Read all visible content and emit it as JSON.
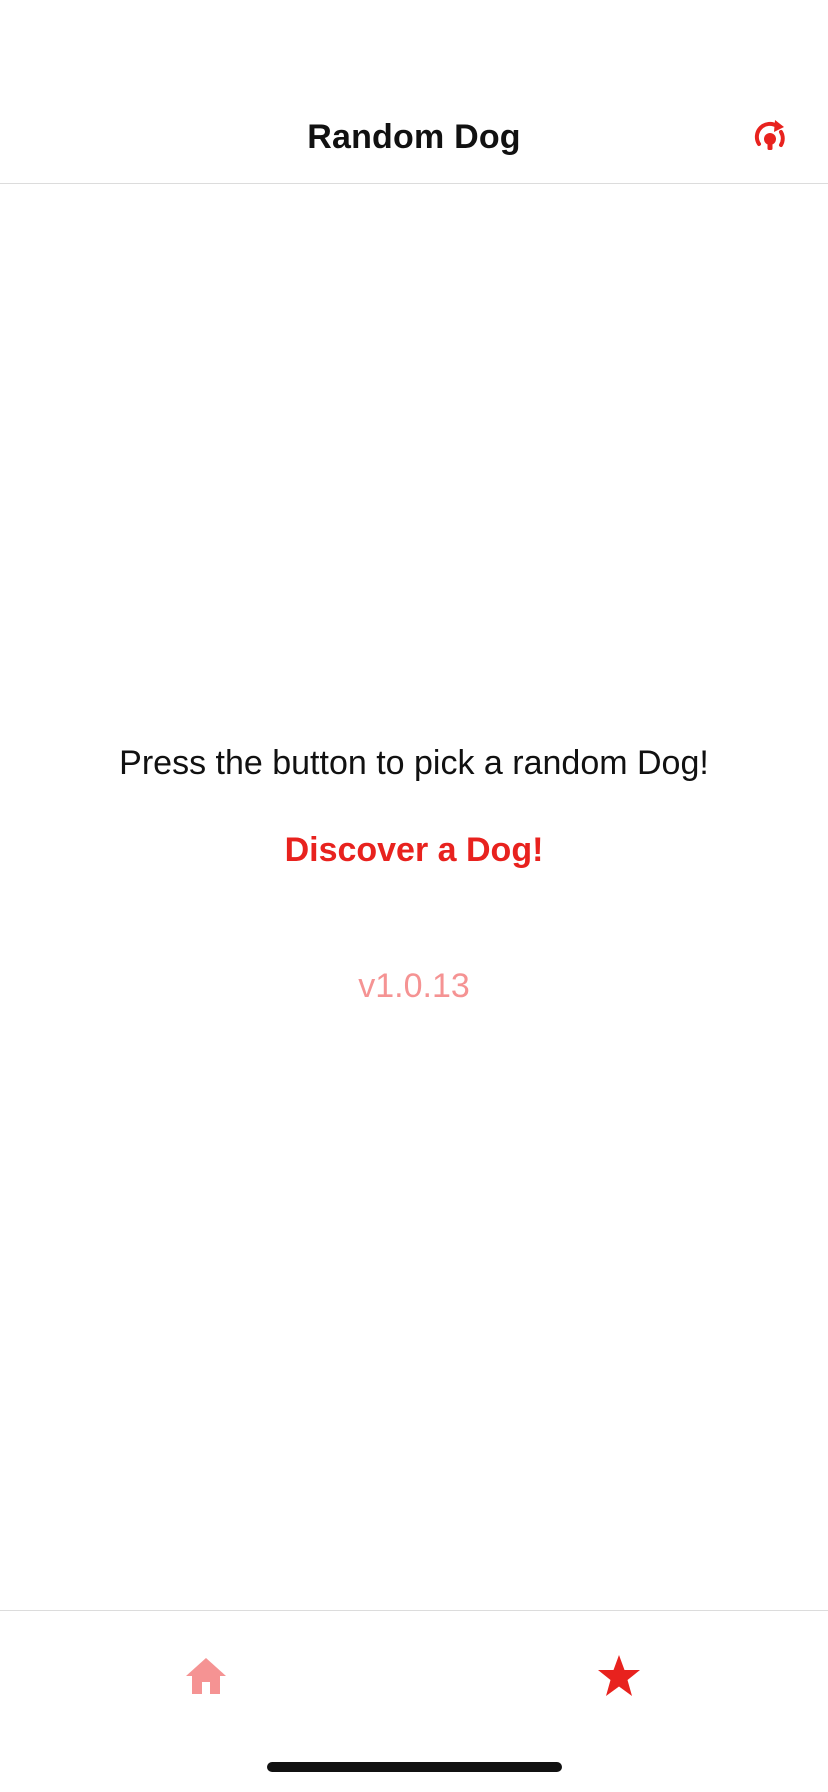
{
  "colors": {
    "accent": "#e8221e",
    "accent_light": "#f59393",
    "text": "#111111",
    "divider": "#dcdcdc"
  },
  "nav": {
    "title": "Random Dog",
    "action_icon": "refresh-bulb-icon"
  },
  "main": {
    "prompt": "Press the button to pick a random Dog!",
    "discover_label": "Discover a Dog!",
    "version": "v1.0.13"
  },
  "tabs": [
    {
      "icon": "home-icon",
      "active": false
    },
    {
      "icon": "star-icon",
      "active": true
    }
  ]
}
